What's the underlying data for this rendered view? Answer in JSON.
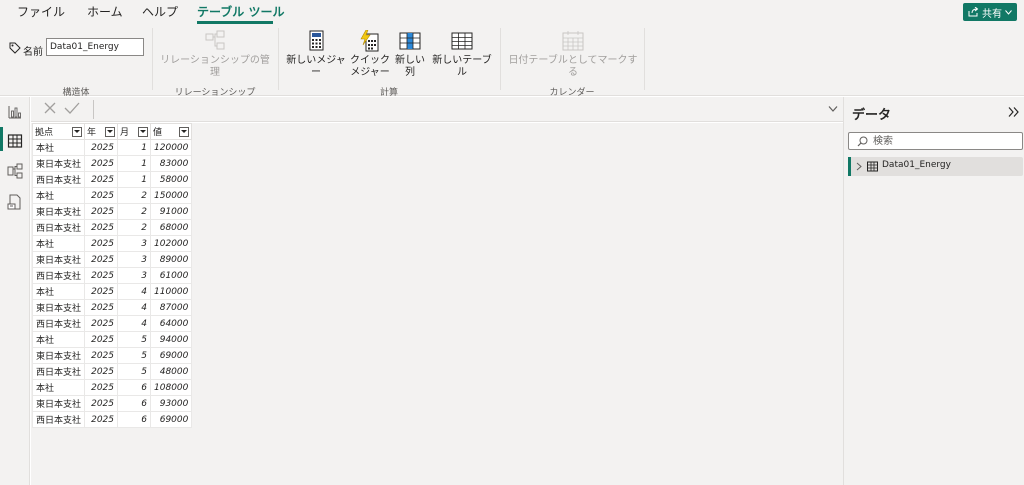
{
  "menu": {
    "tabs": [
      "ファイル",
      "ホーム",
      "ヘルプ",
      "テーブル ツール"
    ],
    "share_label": "共有"
  },
  "ribbon": {
    "name_label": "名前",
    "name_value": "Data01_Energy",
    "groups": {
      "structure": "構造体",
      "relationships": "リレーションシップ",
      "calculations": "計算",
      "calendar": "カレンダー"
    },
    "buttons": {
      "manage_relationships": "リレーションシップの管理",
      "new_measure": "新しいメジャー",
      "quick_measure_1": "クイック",
      "quick_measure_2": "メジャー",
      "new_column": "新しい列",
      "new_table": "新しいテーブル",
      "mark_date_table": "日付テーブルとしてマークする"
    }
  },
  "table": {
    "headers": [
      "拠点",
      "年",
      "月",
      "値"
    ],
    "rows": [
      [
        "本社",
        "2025",
        "1",
        "120000"
      ],
      [
        "東日本支社",
        "2025",
        "1",
        "83000"
      ],
      [
        "西日本支社",
        "2025",
        "1",
        "58000"
      ],
      [
        "本社",
        "2025",
        "2",
        "150000"
      ],
      [
        "東日本支社",
        "2025",
        "2",
        "91000"
      ],
      [
        "西日本支社",
        "2025",
        "2",
        "68000"
      ],
      [
        "本社",
        "2025",
        "3",
        "102000"
      ],
      [
        "東日本支社",
        "2025",
        "3",
        "89000"
      ],
      [
        "西日本支社",
        "2025",
        "3",
        "61000"
      ],
      [
        "本社",
        "2025",
        "4",
        "110000"
      ],
      [
        "東日本支社",
        "2025",
        "4",
        "87000"
      ],
      [
        "西日本支社",
        "2025",
        "4",
        "64000"
      ],
      [
        "本社",
        "2025",
        "5",
        "94000"
      ],
      [
        "東日本支社",
        "2025",
        "5",
        "69000"
      ],
      [
        "西日本支社",
        "2025",
        "5",
        "48000"
      ],
      [
        "本社",
        "2025",
        "6",
        "108000"
      ],
      [
        "東日本支社",
        "2025",
        "6",
        "93000"
      ],
      [
        "西日本支社",
        "2025",
        "6",
        "69000"
      ]
    ]
  },
  "data_pane": {
    "title": "データ",
    "search_placeholder": "検索",
    "table_name": "Data01_Energy"
  },
  "colors": {
    "accent": "#117865",
    "chrome": "#f3f2f1",
    "border": "#e1dfdd"
  },
  "icons": [
    "tag-icon",
    "relationships-icon",
    "calculator-icon",
    "quick-measure-icon",
    "new-column-icon",
    "new-table-icon",
    "calendar-icon",
    "report-view-icon",
    "table-view-icon",
    "model-view-icon",
    "dax-query-icon",
    "cancel-icon",
    "commit-icon",
    "chevron-down-icon",
    "collapse-pane-icon",
    "search-icon",
    "chevron-right-icon",
    "table-icon",
    "share-icon"
  ]
}
